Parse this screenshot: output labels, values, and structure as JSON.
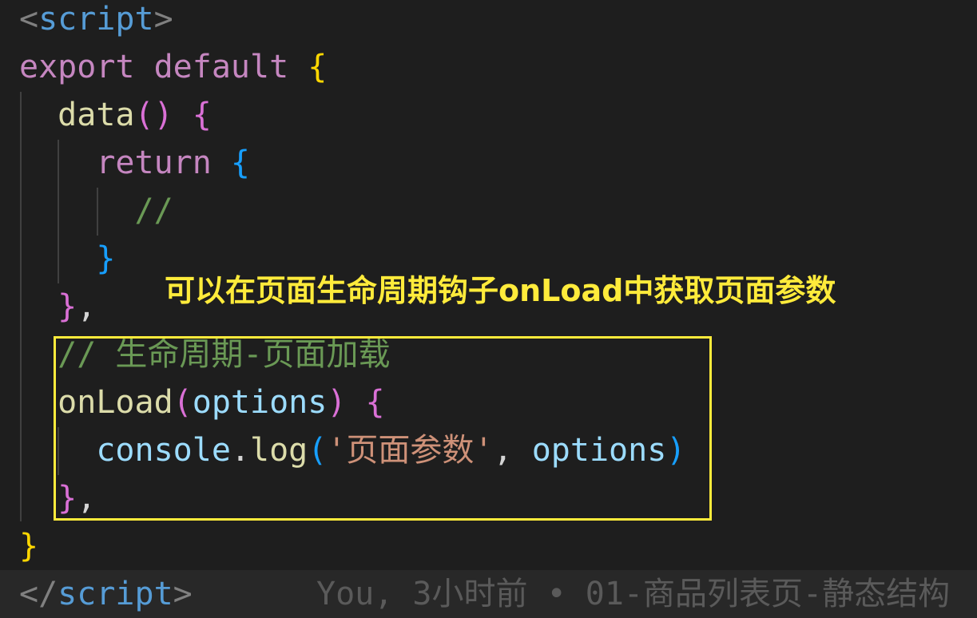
{
  "editor": {
    "lines": {
      "l1": {
        "open": "<",
        "tag": "script",
        "close": ">"
      },
      "l2": {
        "kw1": "export",
        "kw2": "default",
        "brace": "{"
      },
      "l3": {
        "fn": "data",
        "paren": "()",
        "brace": "{"
      },
      "l4": {
        "kw": "return",
        "brace": "{"
      },
      "l5": {
        "comment": "//"
      },
      "l6": {
        "brace": "}"
      },
      "l7": {
        "brace": "}",
        "comma": ","
      },
      "l8": {
        "comment": "// 生命周期-页面加载"
      },
      "l9": {
        "fn": "onLoad",
        "paren_open": "(",
        "param": "options",
        "paren_close": ")",
        "brace": "{"
      },
      "l10": {
        "obj": "console",
        "dot": ".",
        "method": "log",
        "paren_open": "(",
        "str": "'页面参数'",
        "comma": ",",
        "arg": "options",
        "paren_close": ")"
      },
      "l11": {
        "brace": "}",
        "comma": ","
      },
      "l12": {
        "brace": "}"
      },
      "l13": {
        "open": "</",
        "tag": "script",
        "close": ">"
      }
    },
    "git_blame": "You, 3小时前 • 01-商品列表页-静态结构"
  },
  "annotation": {
    "text": "可以在页面生命周期钩子onLoad中获取页面参数",
    "color": "#ffeb3b"
  },
  "colors": {
    "background": "#1e1e1e",
    "keyword": "#c586c0",
    "function": "#dcdcaa",
    "variable": "#9cdcfe",
    "comment": "#6a9955",
    "string": "#ce9178",
    "tag": "#569cd6",
    "highlight_box": "#ffeb3b"
  }
}
